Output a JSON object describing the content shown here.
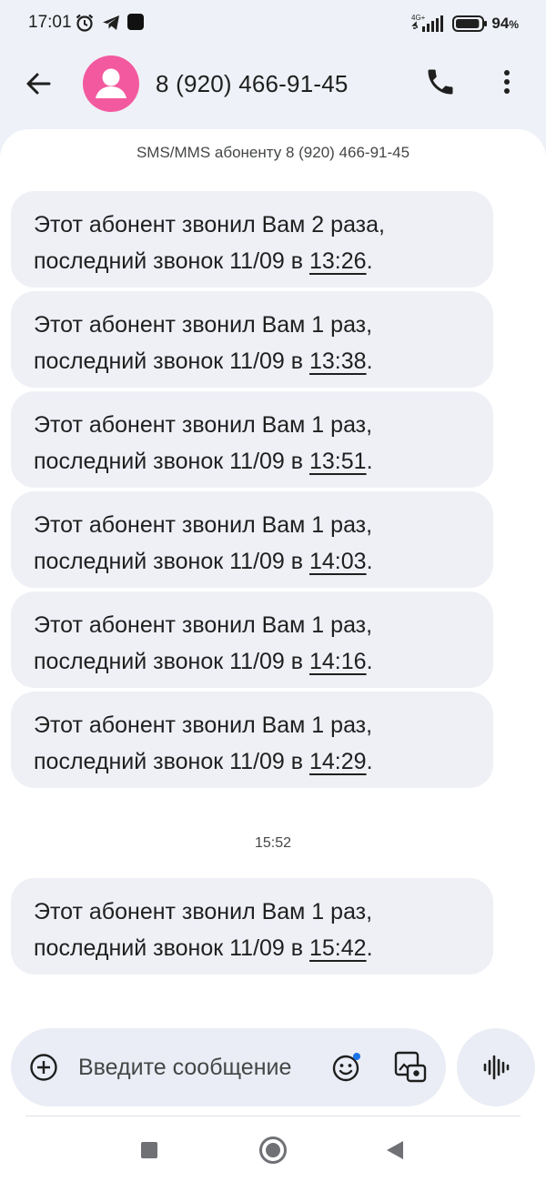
{
  "status_bar": {
    "time": "17:01",
    "network": "4G+",
    "battery_percent": "94",
    "battery_unit": "%",
    "battery_level": 0.94,
    "icons": [
      "alarm-icon",
      "telegram-icon",
      "app-notification-icon",
      "signal-icon",
      "battery-icon"
    ]
  },
  "header": {
    "contact_name": "8 (920) 466-91-45",
    "avatar_color": "#f3599f"
  },
  "conversation": {
    "channel_note": "SMS/MMS абоненту 8 (920) 466-91-45",
    "messages": [
      {
        "line1": "Этот абонент звонил Вам 2 раза,",
        "line2_prefix": "последний звонок 11/09 в ",
        "time": "13:26",
        "suffix": "."
      },
      {
        "line1": "Этот абонент звонил Вам 1 раз,",
        "line2_prefix": "последний звонок 11/09 в ",
        "time": "13:38",
        "suffix": "."
      },
      {
        "line1": "Этот абонент звонил Вам 1 раз,",
        "line2_prefix": "последний звонок 11/09 в ",
        "time": "13:51",
        "suffix": "."
      },
      {
        "line1": "Этот абонент звонил Вам 1 раз,",
        "line2_prefix": "последний звонок 11/09 в ",
        "time": "14:03",
        "suffix": "."
      },
      {
        "line1": "Этот абонент звонил Вам 1 раз,",
        "line2_prefix": "последний звонок 11/09 в ",
        "time": "14:16",
        "suffix": "."
      },
      {
        "line1": "Этот абонент звонил Вам 1 раз,",
        "line2_prefix": "последний звонок 11/09 в ",
        "time": "14:29",
        "suffix": "."
      }
    ],
    "time_separator": "15:52",
    "latest_message": {
      "line1": "Этот абонент звонил Вам 1 раз,",
      "line2_prefix": "последний звонок 11/09 в ",
      "time": "15:42",
      "suffix": "."
    }
  },
  "composer": {
    "placeholder": "Введите сообщение"
  },
  "colors": {
    "background": "#eef1f7",
    "bubble": "#eef0f6",
    "accent": "#1a73e8"
  }
}
